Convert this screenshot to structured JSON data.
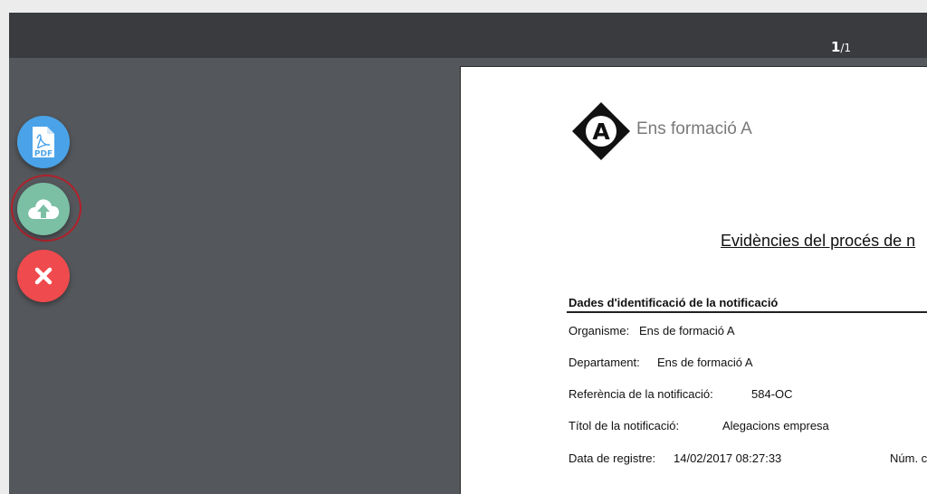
{
  "toolbar": {
    "page_current": "1",
    "page_separator": "/",
    "page_total": "1"
  },
  "actions": {
    "pdf_label": "PDF",
    "pdf_icon": "pdf-file-icon",
    "upload_icon": "cloud-upload-icon",
    "close_icon": "close-icon"
  },
  "colors": {
    "pdf_button": "#4aa3e8",
    "upload_button": "#7bbfa5",
    "close_button": "#ef4a4d",
    "highlight_ring": "#b3202a"
  },
  "document": {
    "logo_letter": "A",
    "organization": "Ens formació A",
    "title": "Evidències del procés de n",
    "section_heading": "Dades d'identificació de la notificació",
    "fields": [
      {
        "label": "Organisme:",
        "value": "Ens de formació A"
      },
      {
        "label": "Departament:",
        "value": "Ens de formació A"
      },
      {
        "label": "Referència de la notificació:",
        "value": "584-OC"
      },
      {
        "label": "Títol de la notificació:",
        "value": "Alegacions empresa"
      },
      {
        "label": "Data de registre:",
        "value": "14/02/2017 08:27:33"
      }
    ],
    "num_label": "Núm. c"
  }
}
